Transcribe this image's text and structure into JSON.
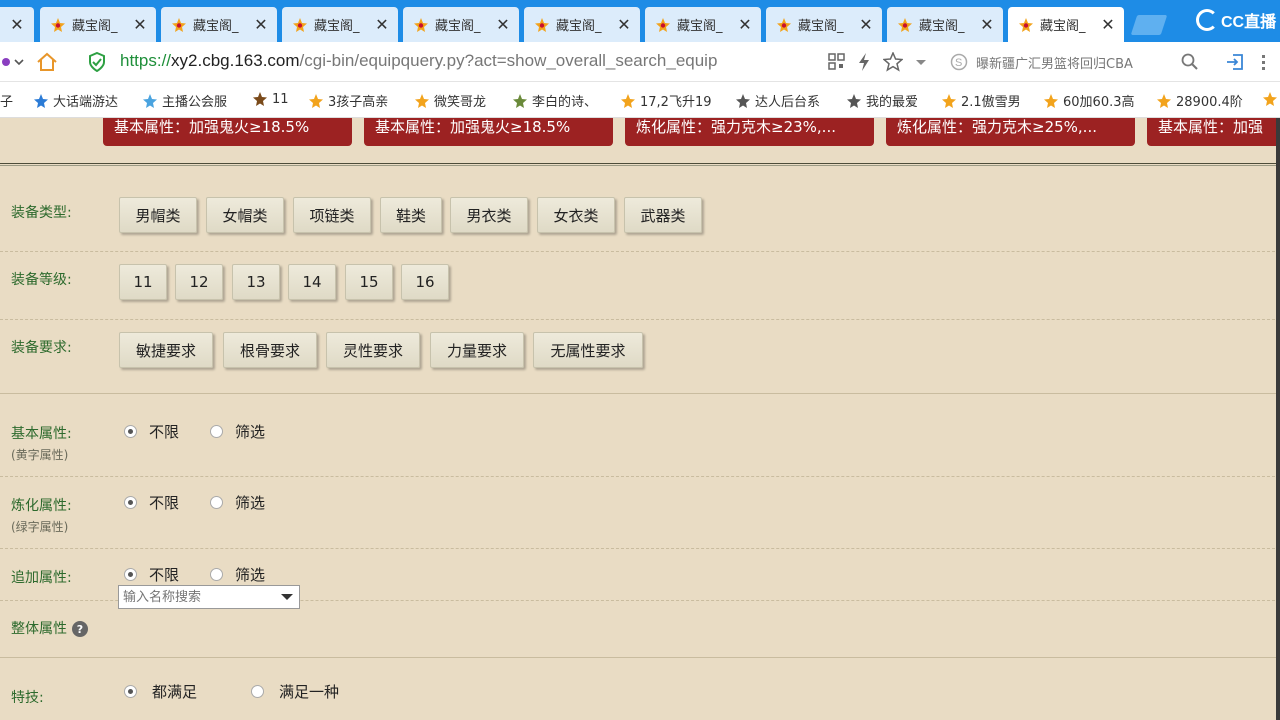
{
  "browser": {
    "tabs": [
      {
        "title": "藏宝阁_",
        "active": false
      },
      {
        "title": "藏宝阁_",
        "active": false
      },
      {
        "title": "藏宝阁_",
        "active": false
      },
      {
        "title": "藏宝阁_",
        "active": false
      },
      {
        "title": "藏宝阁_",
        "active": false
      },
      {
        "title": "藏宝阁_",
        "active": false
      },
      {
        "title": "藏宝阁_",
        "active": false
      },
      {
        "title": "藏宝阁_",
        "active": false
      },
      {
        "title": "藏宝阁_",
        "active": true
      }
    ],
    "tab_close_glyph": "✕",
    "overlay_logo": "CC直播",
    "url": {
      "scheme": "https://",
      "host": "xy2.cbg.163.com",
      "path": "/cgi-bin/equipquery.py?act=show_overall_search_equip"
    },
    "search_text": "曝新疆广汇男篮将回归CBA",
    "bookmarks": [
      "子",
      "大话端游达",
      "主播公会服",
      "11",
      "3孩子高亲",
      "微笑哥龙",
      "李白的诗、",
      "17,2飞升19",
      "达人后台系",
      "我的最爱",
      "2.1傲雪男",
      "60加60.3高",
      "28900.4阶"
    ]
  },
  "page": {
    "chips": [
      "基本属性：加强鬼火≥18.5%",
      "基本属性：加强鬼火≥18.5%",
      "炼化属性：强力克木≥23%,...",
      "炼化属性：强力克木≥25%,...",
      "基本属性：加强"
    ],
    "equip_type": {
      "label": "装备类型:",
      "options": [
        "男帽类",
        "女帽类",
        "项链类",
        "鞋类",
        "男衣类",
        "女衣类",
        "武器类"
      ]
    },
    "equip_level": {
      "label": "装备等级:",
      "options": [
        "11",
        "12",
        "13",
        "14",
        "15",
        "16"
      ]
    },
    "equip_req": {
      "label": "装备要求:",
      "options": [
        "敏捷要求",
        "根骨要求",
        "灵性要求",
        "力量要求",
        "无属性要求"
      ]
    },
    "basic_attr": {
      "label": "基本属性:",
      "sub": "(黄字属性)",
      "opt_all": "不限",
      "opt_filter": "筛选",
      "selected": "all"
    },
    "refine_attr": {
      "label": "炼化属性:",
      "sub": "(绿字属性)",
      "opt_all": "不限",
      "opt_filter": "筛选",
      "selected": "all"
    },
    "extra_attr": {
      "label": "追加属性:",
      "opt_all": "不限",
      "opt_filter": "筛选",
      "selected": "all"
    },
    "overall_attr": {
      "label": "整体属性",
      "help": "?"
    },
    "skill": {
      "label": "特技:",
      "opt_all": "都满足",
      "opt_any": "满足一种",
      "selected": "all",
      "input_placeholder": "输入名称搜索"
    }
  },
  "colors": {
    "tabbar": "#1e8ce6",
    "page_bg": "#e9dcc4",
    "chip_bg": "#9c2222",
    "label_green": "#2d6a2d"
  }
}
